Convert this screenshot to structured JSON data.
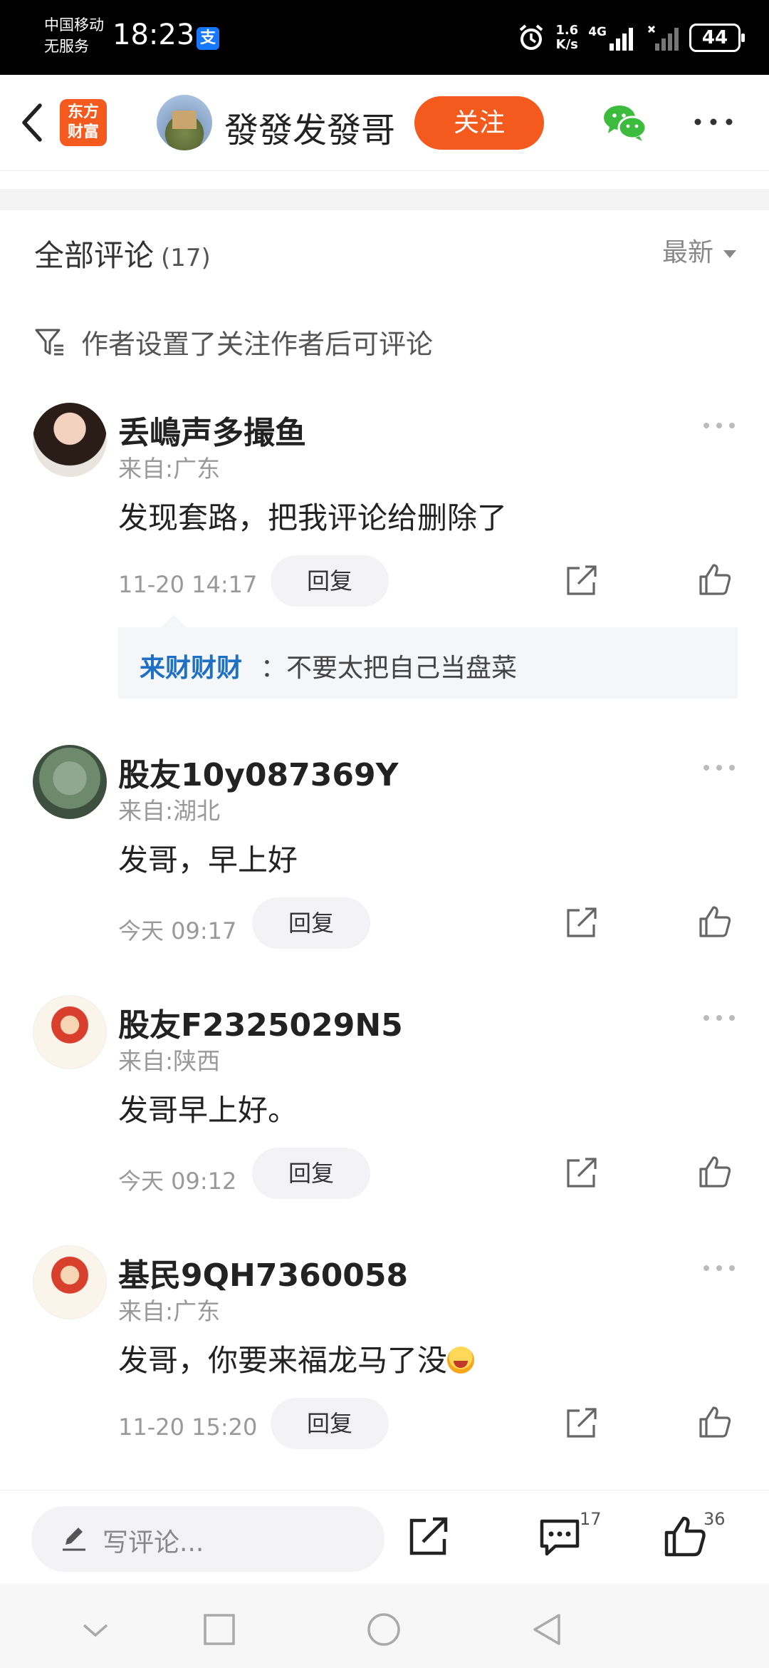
{
  "status_bar": {
    "carrier_line1": "中国移动",
    "carrier_line2": "无服务",
    "time": "18:23",
    "pay_badge": "支",
    "net_speed_value": "1.6",
    "net_speed_unit": "K/s",
    "network": "4G",
    "battery": "44"
  },
  "header": {
    "logo_line1": "东方",
    "logo_line2": "财富",
    "author_name": "發發发發哥",
    "follow_label": "关注"
  },
  "comments_section": {
    "title": "全部评论",
    "count": "(17)",
    "sort_label": "最新",
    "notice": "作者设置了关注作者后可评论"
  },
  "comments": [
    {
      "name": "丢嶋声多撮鱼",
      "location": "来自:广东",
      "text": "发现套路，把我评论给删除了",
      "time": "11-20 14:17",
      "reply_label": "回复",
      "sub_reply": {
        "user": "来财财财",
        "text": "：不要太把自己当盘菜"
      }
    },
    {
      "name": "股友10y087369Y",
      "location": "来自:湖北",
      "text": "发哥，早上好",
      "time": "今天 09:17",
      "reply_label": "回复"
    },
    {
      "name": "股友F2325029N5",
      "location": "来自:陕西",
      "text": "发哥早上好。",
      "time": "今天 09:12",
      "reply_label": "回复"
    },
    {
      "name": "基民9QH7360058",
      "location": "来自:广东",
      "text": "发哥，你要来福龙马了没",
      "emoji": "grinning-squint-emoji",
      "time": "11-20 15:20",
      "reply_label": "回复"
    }
  ],
  "bottom_bar": {
    "input_placeholder": "写评论...",
    "comment_count": "17",
    "like_count": "36"
  },
  "colors": {
    "accent": "#f45a1e",
    "link_blue": "#1e6fc6",
    "wechat_green": "#3dbb3d"
  }
}
